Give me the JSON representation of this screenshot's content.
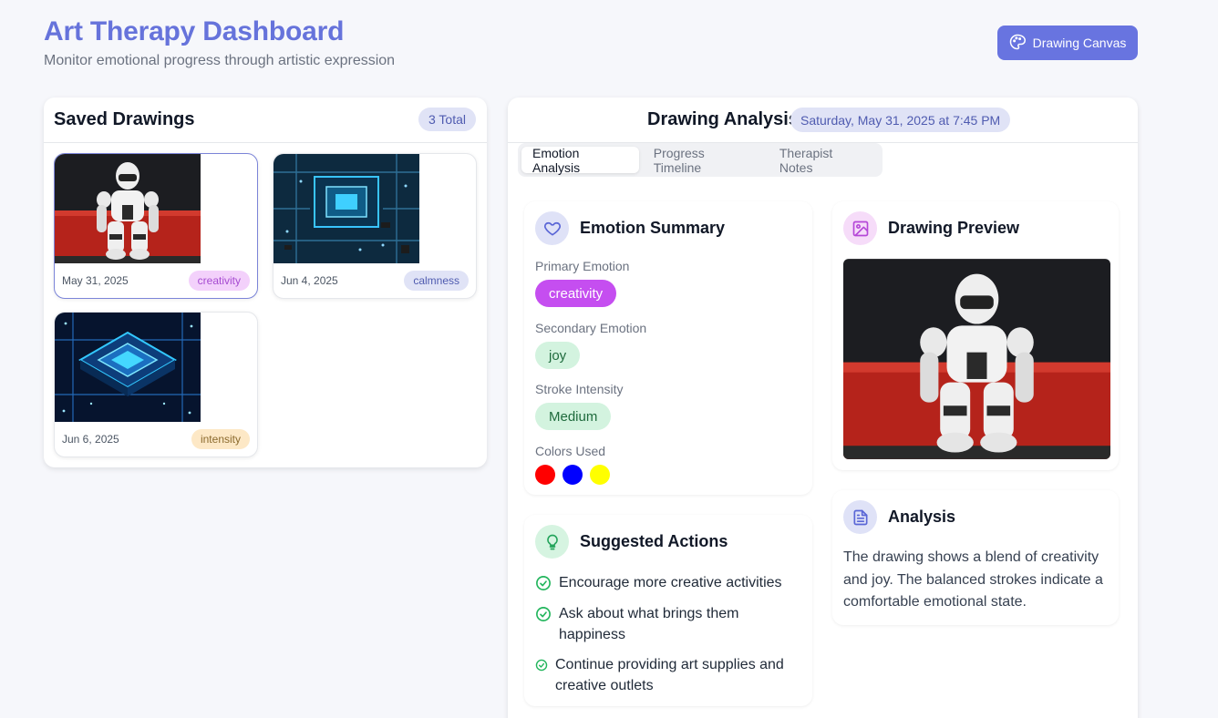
{
  "header": {
    "title": "Art Therapy Dashboard",
    "subtitle": "Monitor emotional progress through artistic expression",
    "canvas_button": "Drawing Canvas",
    "canvas_icon": "palette-icon"
  },
  "saved": {
    "title": "Saved Drawings",
    "total": "3 Total",
    "items": [
      {
        "date": "May 31, 2025",
        "emotion": "creativity",
        "image": "robot-image",
        "selected": true
      },
      {
        "date": "Jun 4, 2025",
        "emotion": "calmness",
        "image": "circuit-board-image",
        "selected": false
      },
      {
        "date": "Jun 6, 2025",
        "emotion": "intensity",
        "image": "microchip-image",
        "selected": false
      }
    ]
  },
  "analysis": {
    "title": "Drawing Analysis",
    "timestamp": "Saturday, May 31, 2025 at 7:45 PM",
    "tabs": [
      "Emotion Analysis",
      "Progress Timeline",
      "Therapist Notes"
    ],
    "active_tab": "Emotion Analysis",
    "summary": {
      "title": "Emotion Summary",
      "icon": "heart-icon",
      "primary_label": "Primary Emotion",
      "primary_value": "creativity",
      "secondary_label": "Secondary Emotion",
      "secondary_value": "joy",
      "stroke_label": "Stroke Intensity",
      "stroke_value": "Medium",
      "colors_label": "Colors Used",
      "colors": [
        "#ff0000",
        "#0000ff",
        "#ffff00"
      ]
    },
    "preview": {
      "title": "Drawing Preview",
      "icon": "image-icon",
      "image": "robot-image"
    },
    "actions": {
      "title": "Suggested Actions",
      "icon": "lightbulb-icon",
      "items": [
        "Encourage more creative activities",
        "Ask about what brings them happiness",
        "Continue providing art supplies and creative outlets"
      ]
    },
    "text_analysis": {
      "title": "Analysis",
      "icon": "document-icon",
      "body": "The drawing shows a blend of creativity and joy. The balanced strokes indicate a comfortable emotional state."
    }
  },
  "colors": {
    "accent": "#6874e0",
    "title": "#6673db",
    "creativity": "#c54ef0",
    "soft_green": "#d3f3df",
    "check": "#22b55c"
  }
}
